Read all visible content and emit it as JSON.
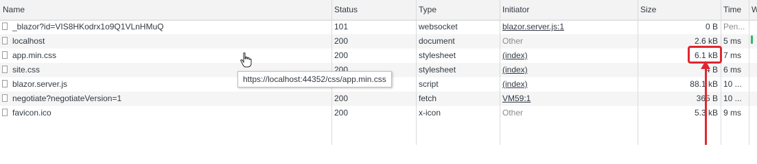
{
  "columns": {
    "name": "Name",
    "status": "Status",
    "type": "Type",
    "initiator": "Initiator",
    "size": "Size",
    "time": "Time",
    "waterfall": "W"
  },
  "rows": [
    {
      "name": "_blazor?id=VIS8HKodrx1o9Q1VLnHMuQ",
      "status": "101",
      "type": "websocket",
      "initiator": "blazor.server.js:1",
      "size": "0 B",
      "time": "Pen..."
    },
    {
      "name": "localhost",
      "status": "200",
      "type": "document",
      "initiator": "Other",
      "size": "2.6 kB",
      "time": "5 ms"
    },
    {
      "name": "app.min.css",
      "status": "200",
      "type": "stylesheet",
      "initiator": "(index)",
      "size": "6.1 kB",
      "time": "7 ms"
    },
    {
      "name": "site.css",
      "status": "200",
      "type": "stylesheet",
      "initiator": "(index)",
      "size": "4 B",
      "time": "6 ms"
    },
    {
      "name": "blazor.server.js",
      "status": "200",
      "type": "script",
      "initiator": "(index)",
      "size": "88.1 kB",
      "time": "10 ..."
    },
    {
      "name": "negotiate?negotiateVersion=1",
      "status": "200",
      "type": "fetch",
      "initiator": "VM59:1",
      "size": "365 B",
      "time": "10 ..."
    },
    {
      "name": "favicon.ico",
      "status": "200",
      "type": "x-icon",
      "initiator": "Other",
      "size": "5.3 kB",
      "time": "9 ms"
    }
  ],
  "tooltip": "https://localhost:44352/css/app.min.css",
  "colors": {
    "annotation": "#e0262f",
    "waterfall": "#3bb36b"
  },
  "icons": {
    "cursor": "hand-pointer-icon",
    "file": "file-icon"
  }
}
